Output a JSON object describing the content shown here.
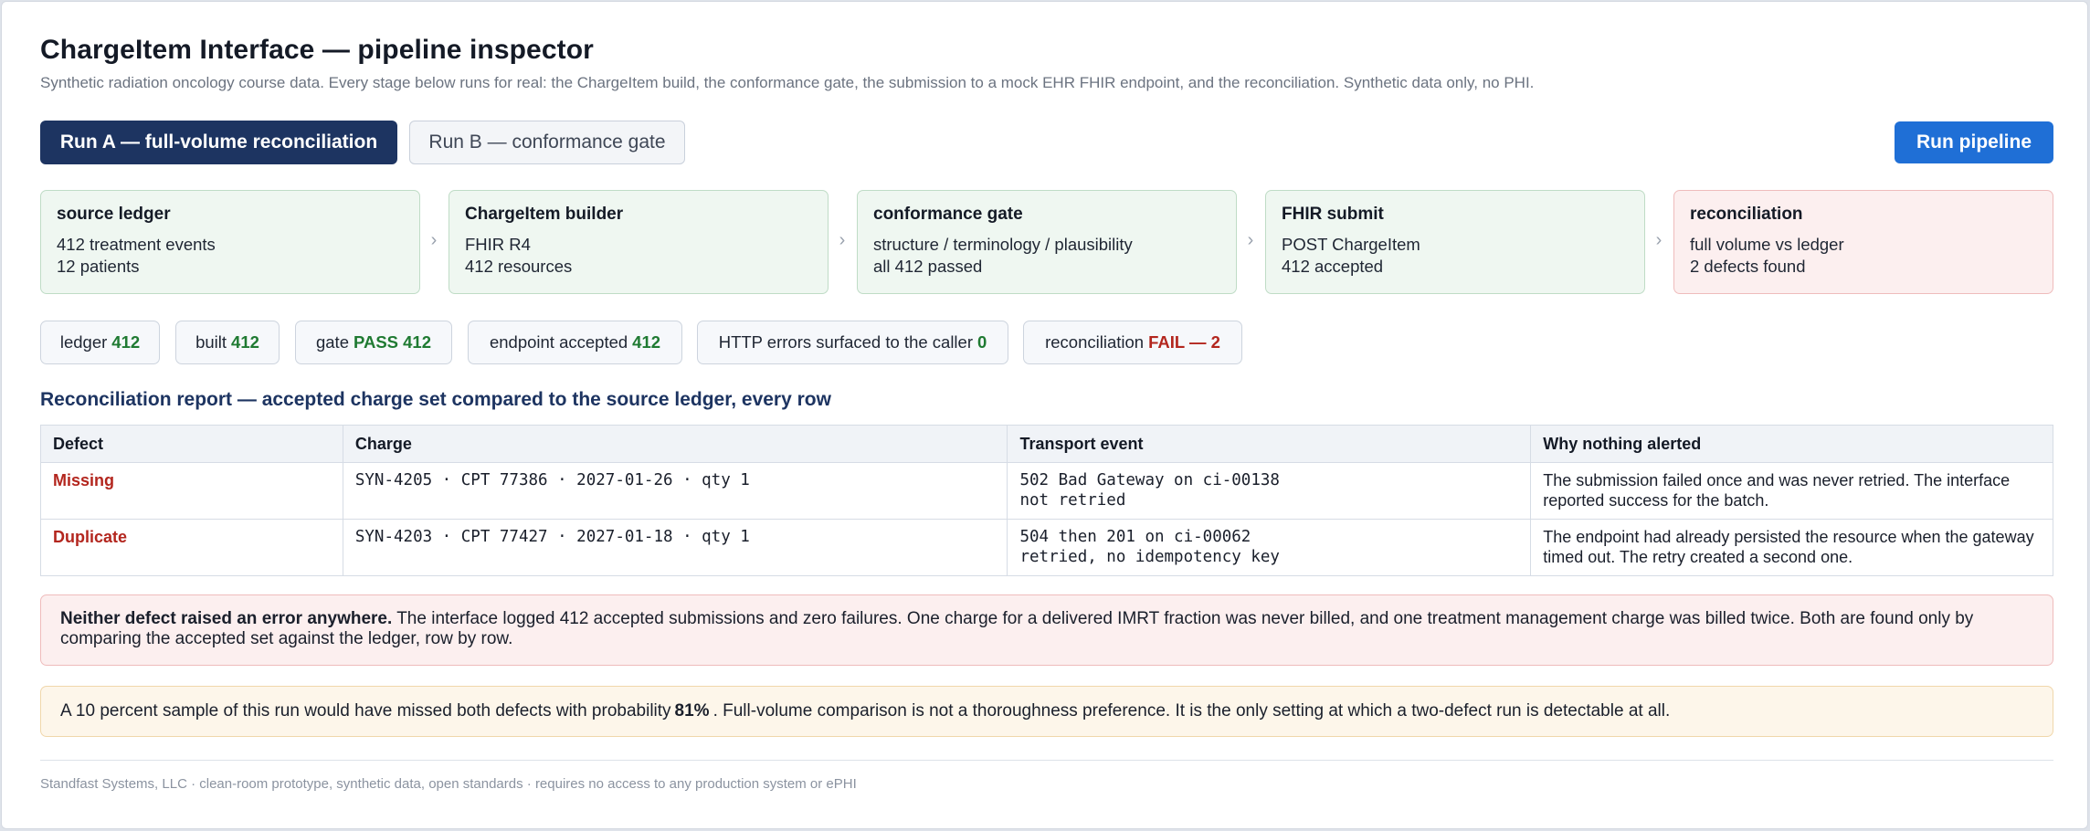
{
  "header": {
    "title": "ChargeItem Interface — pipeline inspector",
    "subtitle": "Synthetic radiation oncology course data. Every stage below runs for real: the ChargeItem build, the conformance gate, the submission to a mock EHR FHIR endpoint, and the reconciliation. Synthetic data only, no PHI."
  },
  "toolbar": {
    "run_a_label": "Run A — full-volume reconciliation",
    "run_b_label": "Run B — conformance gate",
    "run_pipeline_label": "Run pipeline",
    "selected_run": "Run A — full-volume reconciliation"
  },
  "stages": [
    {
      "title": "source ledger",
      "line1": "412 treatment events",
      "line2": "12 patients",
      "status": "ok"
    },
    {
      "title": "ChargeItem builder",
      "line1": "FHIR R4",
      "line2": "412 resources",
      "status": "ok"
    },
    {
      "title": "conformance gate",
      "line1": "structure / terminology / plausibility",
      "line2": "all 412 passed",
      "status": "ok"
    },
    {
      "title": "FHIR submit",
      "line1": "POST ChargeItem",
      "line2": "412 accepted",
      "status": "ok"
    },
    {
      "title": "reconciliation",
      "line1": "full volume vs ledger",
      "line2": "2 defects found",
      "status": "fail"
    }
  ],
  "stage_arrow": "›",
  "chips": [
    {
      "label": "ledger",
      "value": "412",
      "status": "ok"
    },
    {
      "label": "built",
      "value": "412",
      "status": "ok"
    },
    {
      "label": "gate",
      "value": "PASS 412",
      "status": "ok"
    },
    {
      "label": "endpoint accepted",
      "value": "412",
      "status": "ok"
    },
    {
      "label": "HTTP errors surfaced to the caller",
      "value": "0",
      "status": "ok"
    },
    {
      "label": "reconciliation",
      "value": "FAIL — 2",
      "status": "fail"
    }
  ],
  "report": {
    "title": "Reconciliation report — accepted charge set compared to the source ledger, every row",
    "columns": [
      "Defect",
      "Charge",
      "Transport event",
      "Why nothing alerted"
    ],
    "rows": [
      {
        "defect": "Missing",
        "charge": "SYN-4205 · CPT 77386 · 2027-01-26 · qty 1",
        "transport_line1": "502 Bad Gateway on ci-00138",
        "transport_line2": "not retried",
        "why": "The submission failed once and was never retried. The interface reported success for the batch."
      },
      {
        "defect": "Duplicate",
        "charge": "SYN-4203 · CPT 77427 · 2027-01-18 · qty 1",
        "transport_line1": "504 then 201 on ci-00062",
        "transport_line2": "retried, no idempotency key",
        "why": "The endpoint had already persisted the resource when the gateway timed out. The retry created a second one."
      }
    ]
  },
  "alert": {
    "bold": "Neither defect raised an error anywhere.",
    "text": " The interface logged 412 accepted submissions and zero failures. One charge for a delivered IMRT fraction was never billed, and one treatment management charge was billed twice. Both are found only by comparing the accepted set against the ledger, row by row."
  },
  "note": {
    "before": "A 10 percent sample of this run would have missed both defects with probability",
    "value": "81%",
    "after": ". Full-volume comparison is not a thoroughness preference. It is the only setting at which a two-defect run is detectable at all."
  },
  "footer": "Standfast Systems, LLC · clean-room prototype, synthetic data, open standards · requires no access to any production system or ePHI",
  "colors": {
    "primary": "#1d3461",
    "action": "#1f6fd6",
    "ok": "#1f7a32",
    "fail": "#b3261e"
  }
}
